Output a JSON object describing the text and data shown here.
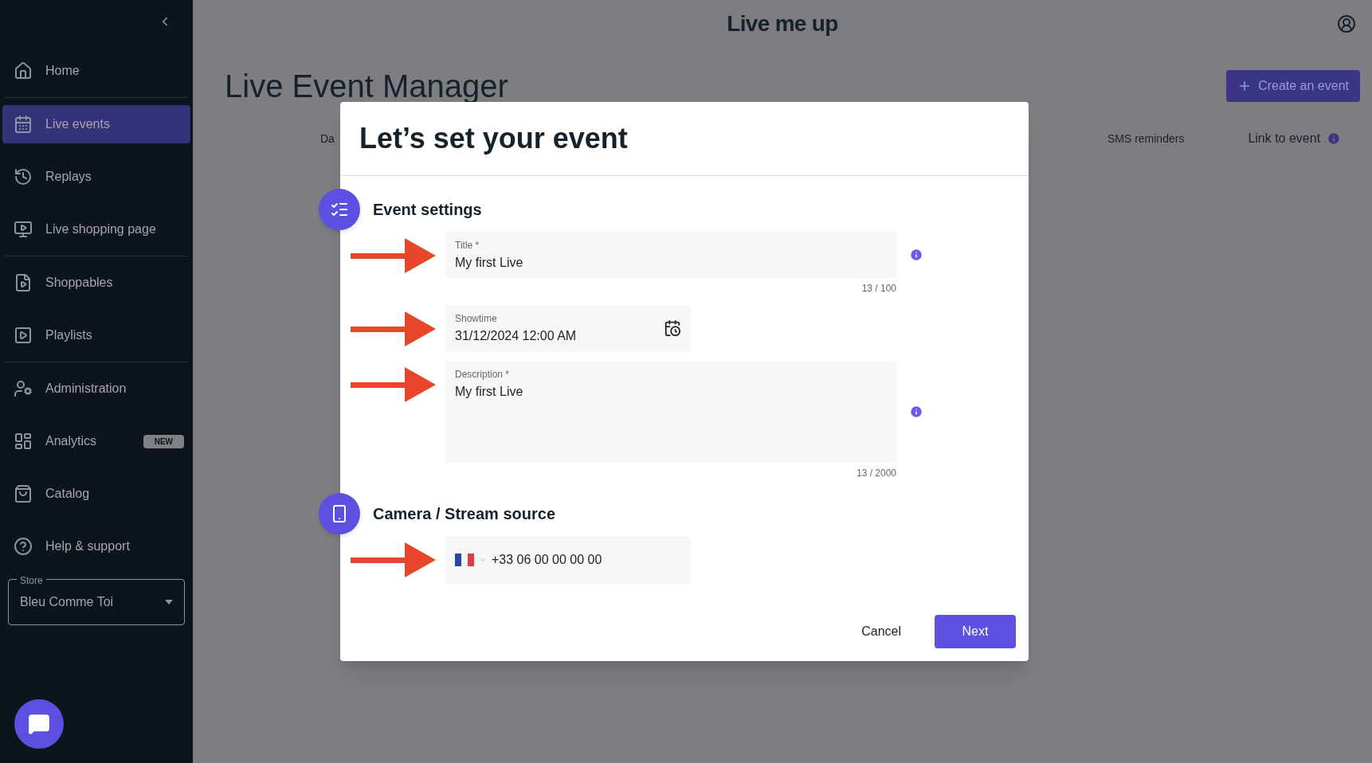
{
  "sidebar": {
    "sections": [
      [
        {
          "label": "Home",
          "selected": false
        }
      ],
      [
        {
          "label": "Live events",
          "selected": true
        },
        {
          "label": "Replays",
          "selected": false
        },
        {
          "label": "Live shopping page",
          "selected": false
        }
      ],
      [
        {
          "label": "Shoppables",
          "selected": false
        },
        {
          "label": "Playlists",
          "selected": false
        }
      ],
      [
        {
          "label": "Administration",
          "selected": false
        },
        {
          "label": "Analytics",
          "selected": false,
          "badge": "NEW"
        },
        {
          "label": "Catalog",
          "selected": false
        },
        {
          "label": "Help & support",
          "selected": false
        }
      ]
    ],
    "store": {
      "label": "Store",
      "value": "Bleu Comme Toi"
    }
  },
  "header": {
    "logo": "Live me up"
  },
  "page": {
    "title": "Live Event Manager",
    "create_button": "Create an event",
    "columns": [
      "Da",
      "SMS reminders",
      "Link to event"
    ]
  },
  "modal": {
    "title": "Let’s set your event",
    "sections": [
      {
        "title": "Event settings",
        "fields": [
          {
            "kind": "text",
            "label": "Title *",
            "value": "My first Live",
            "counter": "13 / 100",
            "info": true,
            "arrow": true
          },
          {
            "kind": "date",
            "label": "Showtime",
            "value": "31/12/2024 12:00 AM",
            "info": false,
            "arrow": true
          },
          {
            "kind": "textarea",
            "label": "Description *",
            "value": "My first Live",
            "counter": "13 / 2000",
            "info": true,
            "arrow": true
          }
        ]
      },
      {
        "title": "Camera / Stream source",
        "fields": [
          {
            "kind": "phone",
            "value": "+33 06 00 00 00 00",
            "info": false,
            "arrow": true
          }
        ]
      }
    ],
    "buttons": {
      "cancel": "Cancel",
      "next": "Next"
    }
  }
}
